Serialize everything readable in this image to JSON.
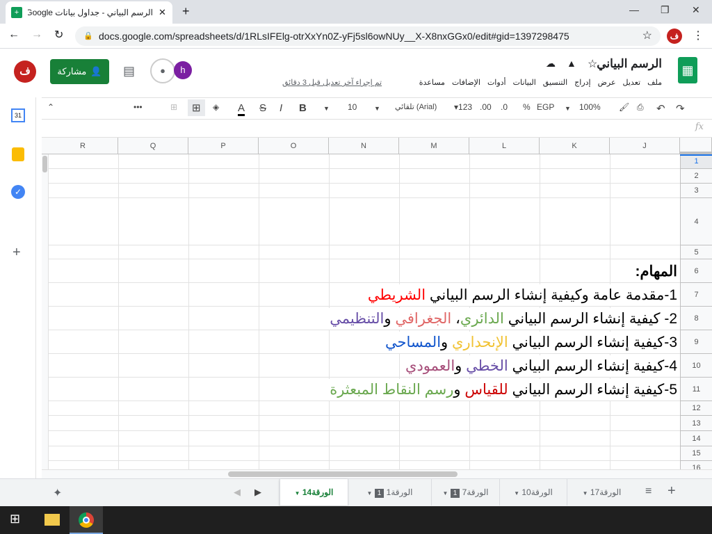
{
  "browser": {
    "tab_title": "الرسم البياني - جداول بيانات Google",
    "url": "docs.google.com/spreadsheets/d/1RLsIFElg-otrXxYn0Z-yFj5sl6owNUy__X-X8nxGGx0/edit#gid=1397298475",
    "profile_initial": "ف"
  },
  "doc": {
    "title": "الرسم البياني",
    "share_label": "مشاركة",
    "user_initial": "ف",
    "collab_initial": "h",
    "menus": [
      "ملف",
      "تعديل",
      "عرض",
      "إدراج",
      "التنسيق",
      "البيانات",
      "أدوات",
      "الإضافات",
      "مساعدة"
    ],
    "last_edit": "تم إجراء آخر تعديل قبل 3 دقائق"
  },
  "toolbar": {
    "zoom": "100%",
    "currency": "EGP",
    "percent": "%",
    "dec_less": ".0",
    "dec_more": ".00",
    "format_more": "123",
    "font": "تلقائي (Arial)",
    "font_size": "10",
    "bold": "B",
    "italic": "I",
    "strike": "S",
    "text_color": "A",
    "more": "•••"
  },
  "formula": {
    "fx": "fx"
  },
  "columns": [
    "J",
    "K",
    "L",
    "M",
    "N",
    "O",
    "P",
    "Q",
    "R"
  ],
  "rows": [
    "1",
    "2",
    "3",
    "4",
    "5",
    "6",
    "7",
    "8",
    "9",
    "10",
    "11",
    "12",
    "13",
    "14",
    "15",
    "16"
  ],
  "cells": [
    {
      "row": 6,
      "parts": [
        {
          "text": "المهام:",
          "color": "#000000",
          "bold": true
        }
      ]
    },
    {
      "row": 7,
      "parts": [
        {
          "text": "1-مقدمة عامة وكيفية إنشاء الرسم البياني ",
          "color": "#000000"
        },
        {
          "text": "الشريطي",
          "color": "#ff0000"
        }
      ]
    },
    {
      "row": 8,
      "parts": [
        {
          "text": "2- كيفية إنشاء الرسم البياني ",
          "color": "#000000"
        },
        {
          "text": "الدائري",
          "color": "#6aa84f"
        },
        {
          "text": "، ",
          "color": "#000000"
        },
        {
          "text": "الجغرافي",
          "color": "#e06666"
        },
        {
          "text": " و",
          "color": "#000000"
        },
        {
          "text": "التنظيمي",
          "color": "#674ea7"
        }
      ]
    },
    {
      "row": 9,
      "parts": [
        {
          "text": "3-كيفية إنشاء الرسم البياني ",
          "color": "#000000"
        },
        {
          "text": "الإنحداري",
          "color": "#f1c232"
        },
        {
          "text": " و",
          "color": "#000000"
        },
        {
          "text": "المساحي",
          "color": "#1155cc"
        }
      ]
    },
    {
      "row": 10,
      "parts": [
        {
          "text": "4-كيفية إنشاء الرسم البياني ",
          "color": "#000000"
        },
        {
          "text": "الخطي",
          "color": "#674ea7"
        },
        {
          "text": " و",
          "color": "#000000"
        },
        {
          "text": "العمودي",
          "color": "#a64d79"
        }
      ]
    },
    {
      "row": 11,
      "parts": [
        {
          "text": "5-كيفية إنشاء الرسم البياني ",
          "color": "#000000"
        },
        {
          "text": "للقياس",
          "color": "#cc0000"
        },
        {
          "text": " و",
          "color": "#000000"
        },
        {
          "text": "رسم النقاط المبعثرة",
          "color": "#6aa84f"
        }
      ]
    }
  ],
  "sheets": [
    {
      "label": "الورقة14",
      "active": true
    },
    {
      "label": "الورقة1",
      "badge": "1"
    },
    {
      "label": "الورقة7",
      "badge": "1"
    },
    {
      "label": "الورقة10"
    },
    {
      "label": "الورقة17"
    }
  ]
}
